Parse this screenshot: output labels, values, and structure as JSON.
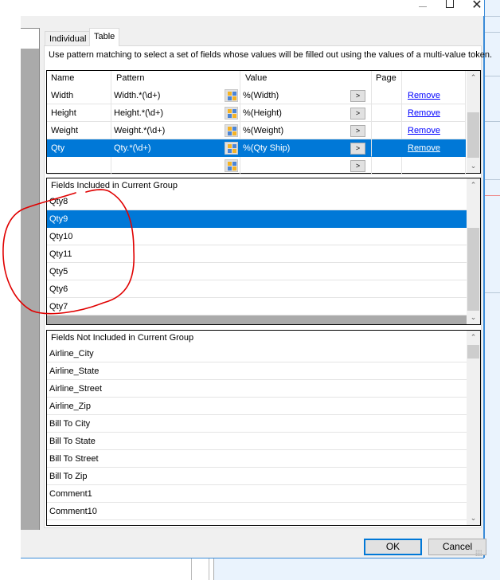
{
  "window": {
    "minimize_label": "",
    "maximize_label": "",
    "close_label": "✕"
  },
  "tabs": [
    {
      "label": "Individual",
      "active": false
    },
    {
      "label": "Table",
      "active": true
    }
  ],
  "description": "Use pattern matching to select a set of fields whose values will be filled out using the values of a multi-value token.",
  "pattern_grid": {
    "columns": [
      "Name",
      "Pattern",
      "Value",
      "Page",
      ""
    ],
    "rows": [
      {
        "name": "Width",
        "pattern": "Width.*(\\d+)",
        "value": "%(Width)",
        "page": "",
        "action": "Remove",
        "selected": false
      },
      {
        "name": "Height",
        "pattern": "Height.*(\\d+)",
        "value": "%(Height)",
        "page": "",
        "action": "Remove",
        "selected": false
      },
      {
        "name": "Weight",
        "pattern": "Weight.*(\\d+)",
        "value": "%(Weight)",
        "page": "",
        "action": "Remove",
        "selected": false
      },
      {
        "name": "Qty",
        "pattern": "Qty.*(\\d+)",
        "value": "%(Qty Ship)",
        "page": "",
        "action": "Remove",
        "selected": true
      },
      {
        "name": "",
        "pattern": "",
        "value": "",
        "page": "",
        "action": "",
        "selected": false
      }
    ],
    "arrow_label": ">",
    "picker_icon": "field-picker-icon"
  },
  "included_fields": {
    "header": "Fields Included in Current Group",
    "items": [
      "Qty8",
      "Qty9",
      "Qty10",
      "Qty11",
      "Qty5",
      "Qty6",
      "Qty7"
    ],
    "selected_index": 1
  },
  "not_included_fields": {
    "header": "Fields Not Included in Current Group",
    "items": [
      "Airline_City",
      "Airline_State",
      "Airline_Street",
      "Airline_Zip",
      "Bill To City",
      "Bill To State",
      "Bill To Street",
      "Bill To Zip",
      "Comment1",
      "Comment10"
    ]
  },
  "scroll_arrows": {
    "up": "⌃",
    "down": "⌄"
  },
  "buttons": {
    "ok": "OK",
    "cancel": "Cancel"
  },
  "colors": {
    "selection": "#0078d7",
    "link": "#0000ff",
    "annotation": "#e00000"
  }
}
